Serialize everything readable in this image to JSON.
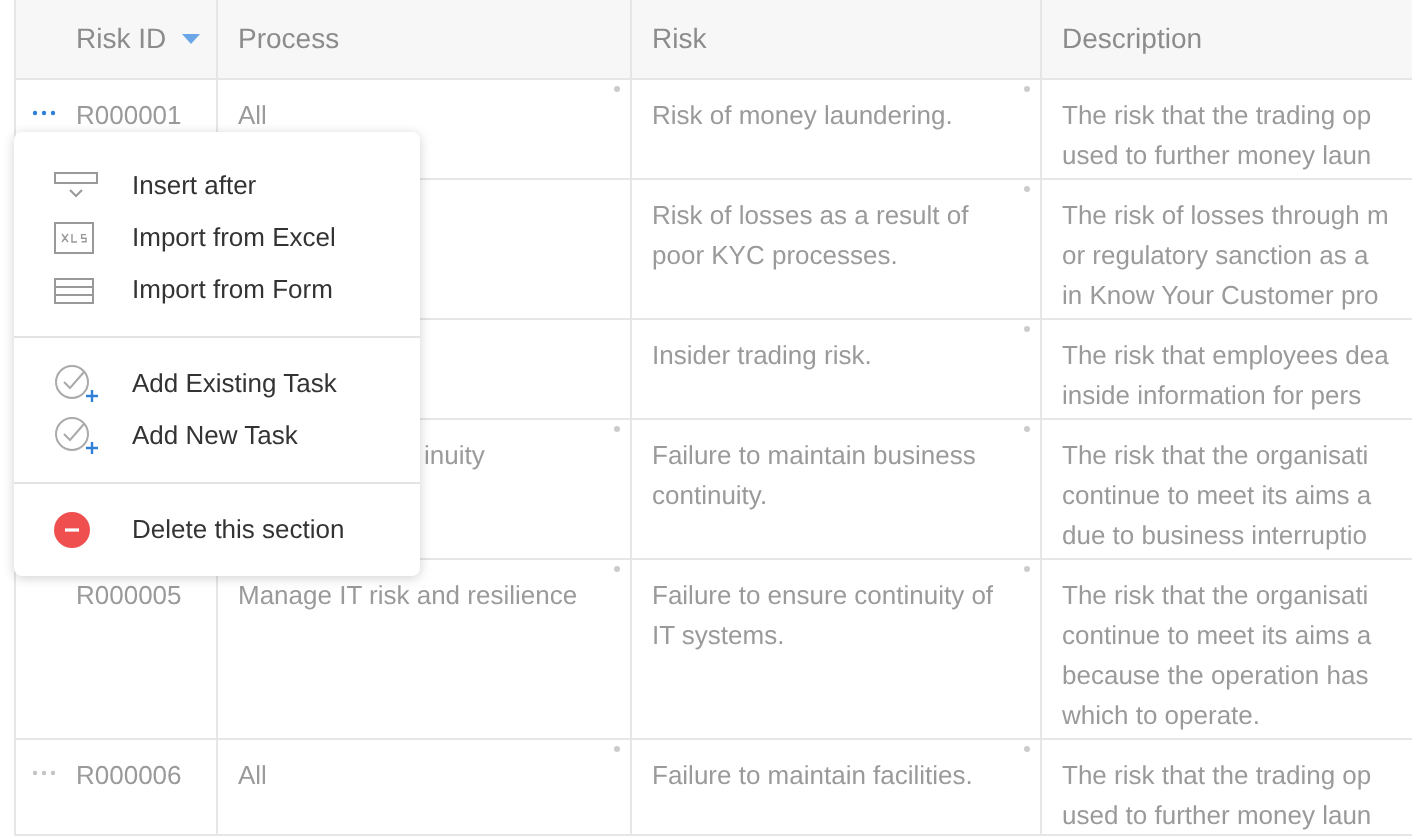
{
  "table": {
    "columns": [
      {
        "label": "Risk ID",
        "sorted": true
      },
      {
        "label": "Process",
        "sorted": false
      },
      {
        "label": "Risk",
        "sorted": false
      },
      {
        "label": "Description",
        "sorted": false
      }
    ],
    "rows": [
      {
        "handle_active": true,
        "id": "R000001",
        "process": "All",
        "risk": "Risk of money laundering.",
        "description": [
          "The risk that the trading op",
          "used to further money laun"
        ]
      },
      {
        "risk": "Risk of losses as a result of poor KYC processes.",
        "description": [
          "The risk of losses through m",
          "or regulatory sanction as a",
          "in Know Your Customer pro"
        ]
      },
      {
        "risk": "Insider trading risk.",
        "description": [
          "The risk that employees dea",
          "inside information for pers"
        ]
      },
      {
        "process": "inuity",
        "process_cut_left": true,
        "risk": "Failure to maintain business continuity.",
        "description": [
          "The risk that the organisati",
          "continue to meet its aims a",
          "due to business interruptio"
        ]
      },
      {
        "id": "R000005",
        "process": "Manage IT risk and resilience",
        "risk": "Failure to ensure continuity of IT systems.",
        "description": [
          "The risk that the organisati",
          "continue to meet its aims a",
          "because the operation has",
          "which to operate."
        ]
      },
      {
        "handle_active": false,
        "id": "R000006",
        "process": "All",
        "risk": "Failure to maintain facilities.",
        "description": [
          "The risk that the trading op",
          "used to further money laun"
        ]
      }
    ]
  },
  "menu": {
    "sections": [
      [
        {
          "kind": "insert",
          "label": "Insert after"
        },
        {
          "kind": "excel",
          "label": "Import from Excel"
        },
        {
          "kind": "form",
          "label": "Import from Form"
        }
      ],
      [
        {
          "kind": "task",
          "label": "Add Existing Task"
        },
        {
          "kind": "task",
          "label": "Add New Task"
        }
      ],
      [
        {
          "kind": "delete",
          "label": "Delete this section"
        }
      ]
    ]
  }
}
